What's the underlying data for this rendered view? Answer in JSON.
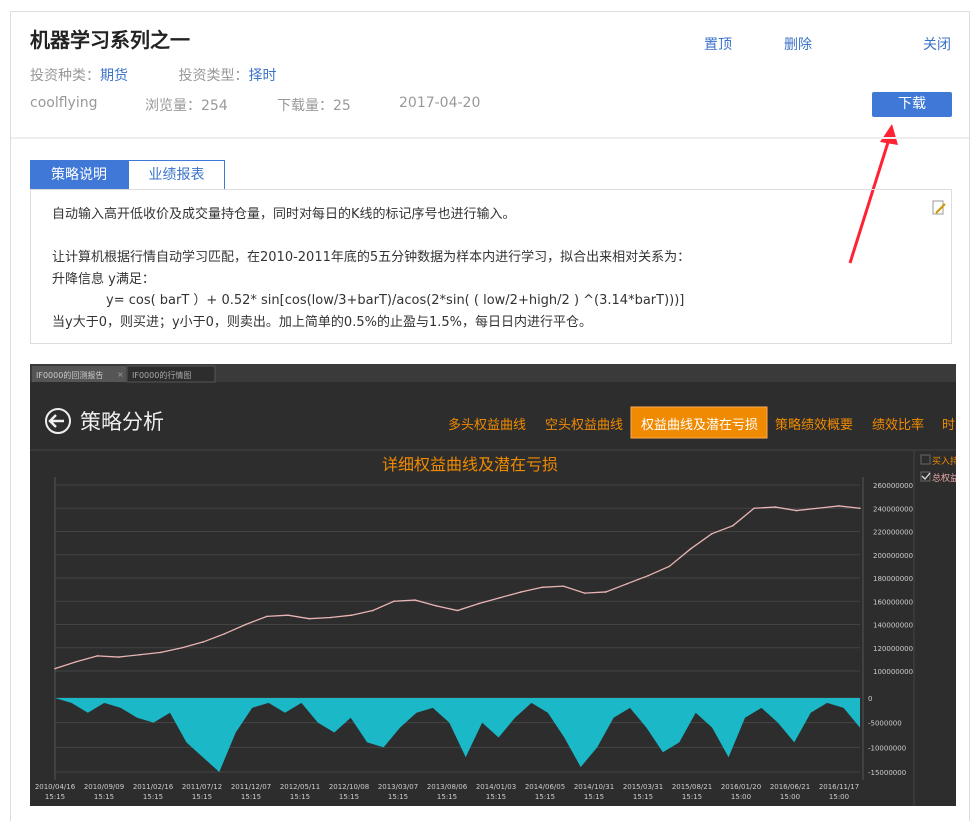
{
  "header": {
    "title": "机器学习系列之一",
    "actions": [
      "置顶",
      "删除",
      "关闭"
    ],
    "invest_kind_label": "投资种类：",
    "invest_kind": "期货",
    "invest_type_label": "投资类型：",
    "invest_type": "择时",
    "author": "coolflying",
    "views": "浏览量：254",
    "downloads": "下载量：25",
    "date": "2017-04-20",
    "download_button": "下载"
  },
  "tabs": [
    "策略说明",
    "业绩报表"
  ],
  "description": [
    "自动输入高开低收价及成交量持仓量，同时对每日的K线的标记序号也进行输入。",
    "",
    "让计算机根据行情自动学习匹配，在2010-2011年底的5五分钟数据为样本内进行学习，拟合出来相对关系为：",
    "升降信息 y满足：",
    "y= cos( barT ）+ 0.52* sin[cos(low/3+barT)/acos(2*sin( ( low/2+high/2 ) ^(3.14*barT)))]",
    "当y大于0，则买进；y小于0，则卖出。加上简单的0.5%的止盈与1.5%，每日日内进行平仓。"
  ],
  "screenshot": {
    "window_tabs": [
      "IF0000的回测报告",
      "IF0000的行情图"
    ],
    "heading": "策略分析",
    "nav": [
      "多头权益曲线",
      "空头权益曲线",
      "权益曲线及潜在亏损",
      "策略绩效概要",
      "绩效比率",
      "时"
    ],
    "active_nav": "权益曲线及潜在亏损",
    "legend": [
      "买入持",
      "总权益"
    ],
    "colors": {
      "accent": "#f08a00",
      "equity_line": "#e8b4b4",
      "drawdown_fill": "#1bb8c8",
      "bg": "#2d2d2d"
    }
  },
  "chart_data": [
    {
      "type": "line",
      "title": "详细权益曲线及潜在亏损",
      "ylim": [
        100000000,
        260000000
      ],
      "yticks": [
        "260000000",
        "240000000",
        "220000000",
        "200000000",
        "180000000",
        "160000000",
        "140000000",
        "120000000",
        "100000000"
      ],
      "xticks": [
        [
          "2010/04/16",
          "15:15"
        ],
        [
          "2010/09/09",
          "15:15"
        ],
        [
          "2011/02/16",
          "15:15"
        ],
        [
          "2011/07/12",
          "15:15"
        ],
        [
          "2011/12/07",
          "15:15"
        ],
        [
          "2012/05/11",
          "15:15"
        ],
        [
          "2012/10/08",
          "15:15"
        ],
        [
          "2013/03/07",
          "15:15"
        ],
        [
          "2013/08/06",
          "15:15"
        ],
        [
          "2014/01/03",
          "15:15"
        ],
        [
          "2014/06/05",
          "15:15"
        ],
        [
          "2014/10/31",
          "15:15"
        ],
        [
          "2015/03/31",
          "15:15"
        ],
        [
          "2015/08/21",
          "15:15"
        ],
        [
          "2016/01/20",
          "15:00"
        ],
        [
          "2016/06/21",
          "15:00"
        ],
        [
          "2016/11/17",
          "15:00"
        ]
      ],
      "series": [
        {
          "values": [
            102,
            108,
            113,
            112,
            114,
            116,
            120,
            125,
            132,
            140,
            147,
            148,
            145,
            146,
            148,
            152,
            160,
            161,
            156,
            152,
            158,
            163,
            168,
            172,
            173,
            167,
            168,
            175,
            182,
            190,
            205,
            218,
            225,
            240,
            241,
            238,
            240,
            242,
            240
          ],
          "unit": "million"
        }
      ]
    },
    {
      "type": "area",
      "ylim": [
        -15000000,
        0
      ],
      "yticks": [
        "0",
        "-5000000",
        "-10000000",
        "-15000000"
      ],
      "series": [
        {
          "values": [
            0,
            -1,
            -3,
            -1,
            -2,
            -4,
            -5,
            -3,
            -9,
            -12,
            -15,
            -7,
            -2,
            -1,
            -3,
            -1,
            -5,
            -7,
            -4,
            -9,
            -10,
            -6,
            -3,
            -2,
            -5,
            -12,
            -5,
            -8,
            -4,
            -1,
            -3,
            -8,
            -14,
            -10,
            -4,
            -2,
            -6,
            -11,
            -9,
            -3,
            -6,
            -12,
            -4,
            -2,
            -5,
            -9,
            -3,
            -1,
            -2,
            -6
          ],
          "unit": "million"
        }
      ]
    }
  ]
}
